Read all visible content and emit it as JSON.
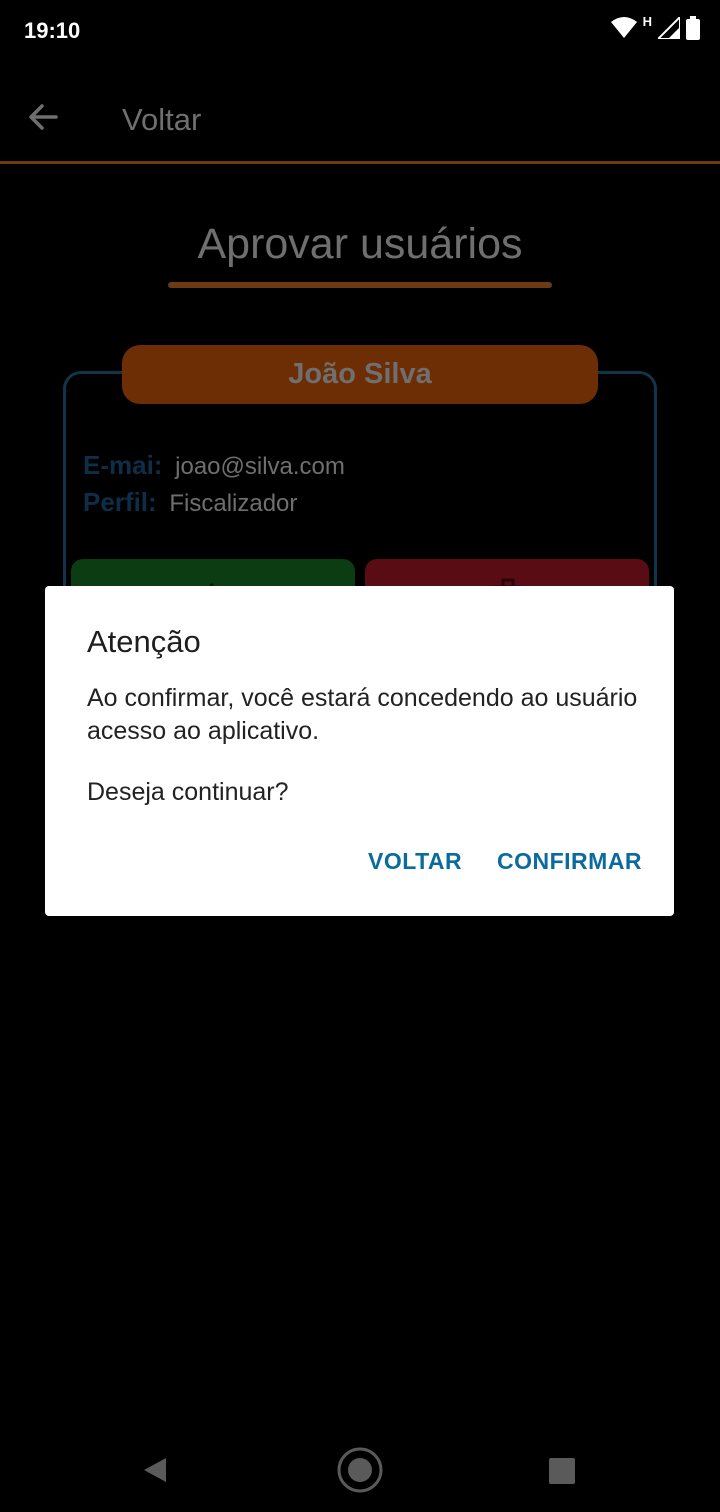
{
  "status_bar": {
    "time": "19:10",
    "network_letter": "H"
  },
  "app_bar": {
    "back_label": "Voltar"
  },
  "page": {
    "title": "Aprovar usuários"
  },
  "card": {
    "name": "João Silva",
    "email_label": "E-mai:",
    "email_value": "joao@silva.com",
    "profile_label": "Perfil:",
    "profile_value": "Fiscalizador"
  },
  "dialog": {
    "title": "Atenção",
    "message": "Ao confirmar, você estará concedendo ao usuário acesso ao aplicativo.",
    "question": "Deseja continuar?",
    "cancel_label": "VOLTAR",
    "confirm_label": "CONFIRMAR"
  },
  "colors": {
    "accent_orange": "#6e3a12",
    "dialog_button": "#0b6a9e",
    "approve_green": "#0c3c12",
    "reject_red": "#5a0c14"
  }
}
